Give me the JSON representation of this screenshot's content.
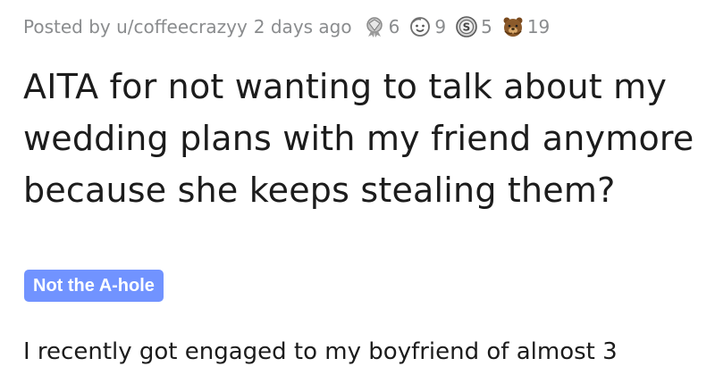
{
  "post": {
    "posted_prefix": "Posted by",
    "username": "u/coffeecrazyy",
    "age": "2 days ago",
    "awards": [
      {
        "icon": "silver-award-icon",
        "count": "6"
      },
      {
        "icon": "wholesome-award-icon",
        "count": "9"
      },
      {
        "icon": "coin-award-icon",
        "count": "5"
      },
      {
        "icon": "bear-award-icon",
        "count": "19"
      }
    ],
    "title": "AITA for not wanting to talk about my wedding plans with my friend anymore because she keeps stealing them?",
    "flair": "Not the A-hole",
    "flair_color": "#7193ff",
    "body": "I recently got engaged to my boyfriend of almost 3"
  }
}
